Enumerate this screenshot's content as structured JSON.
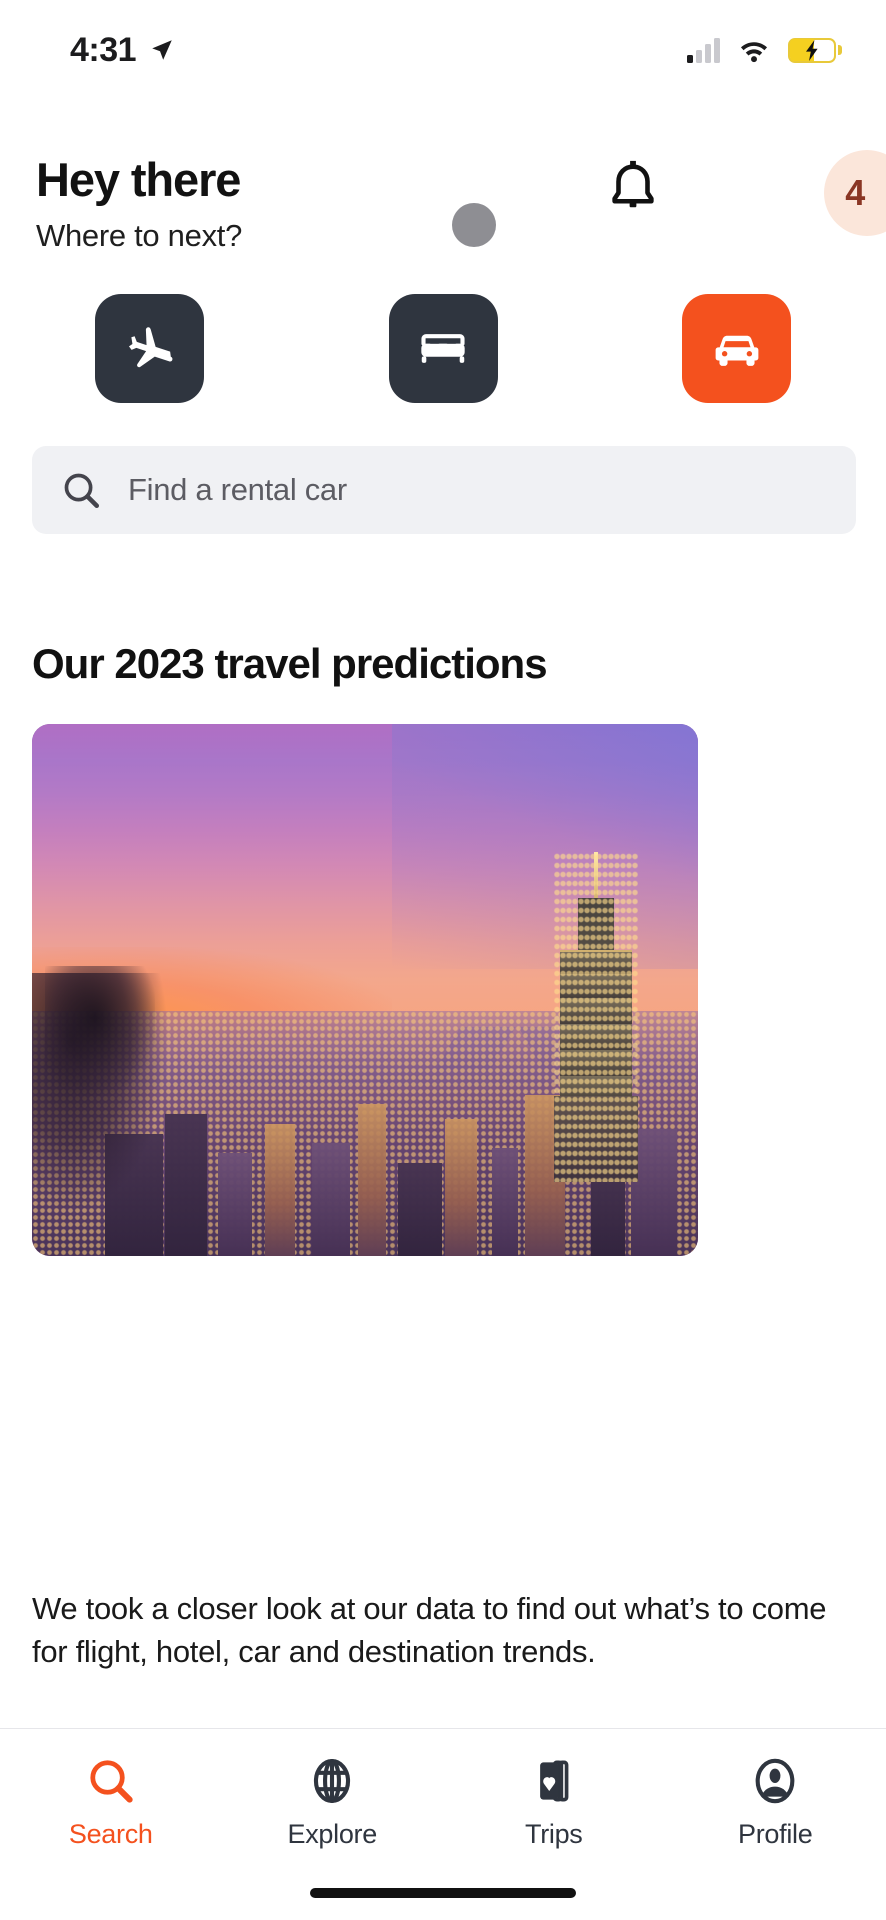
{
  "status_bar": {
    "time": "4:31",
    "location_icon": "location-arrow-icon",
    "signal_icon": "cellular-signal-icon",
    "signal_bars_filled": 1,
    "signal_bars_total": 4,
    "wifi_icon": "wifi-icon",
    "battery_icon": "battery-charging-icon",
    "battery_color": "#f5d020"
  },
  "header": {
    "greeting": "Hey there",
    "subgreeting": "Where to next?",
    "bell_icon": "notification-bell-icon",
    "notification_count": "4",
    "badge_bg": "#fbe6da",
    "badge_text_color": "#8a3624"
  },
  "categories": {
    "items": [
      {
        "name": "flights",
        "icon": "airplane-icon",
        "label": "Flights",
        "active": false,
        "bg": "#2f353f"
      },
      {
        "name": "stays",
        "icon": "bed-icon",
        "label": "Stays",
        "active": false,
        "bg": "#2f353f"
      },
      {
        "name": "cars",
        "icon": "car-icon",
        "label": "Cars",
        "active": true,
        "bg": "#f4511e"
      }
    ]
  },
  "search": {
    "icon": "search-icon",
    "placeholder": "Find a rental car",
    "value": "",
    "bg": "#f0f1f4"
  },
  "section": {
    "title": "Our 2023 travel predictions",
    "image_alt": "taipei-skyline-at-sunset",
    "body": "We took a closer look at our data to find out what’s to come for flight, hotel, car and destination trends."
  },
  "tabbar": {
    "items": [
      {
        "name": "search",
        "label": "Search",
        "icon": "search-icon",
        "active": true
      },
      {
        "name": "explore",
        "label": "Explore",
        "icon": "globe-icon",
        "active": false
      },
      {
        "name": "trips",
        "label": "Trips",
        "icon": "trips-cards-heart-icon",
        "active": false
      },
      {
        "name": "profile",
        "label": "Profile",
        "icon": "person-circle-icon",
        "active": false
      }
    ],
    "active_color": "#f4511e",
    "inactive_color": "#2f353f"
  }
}
